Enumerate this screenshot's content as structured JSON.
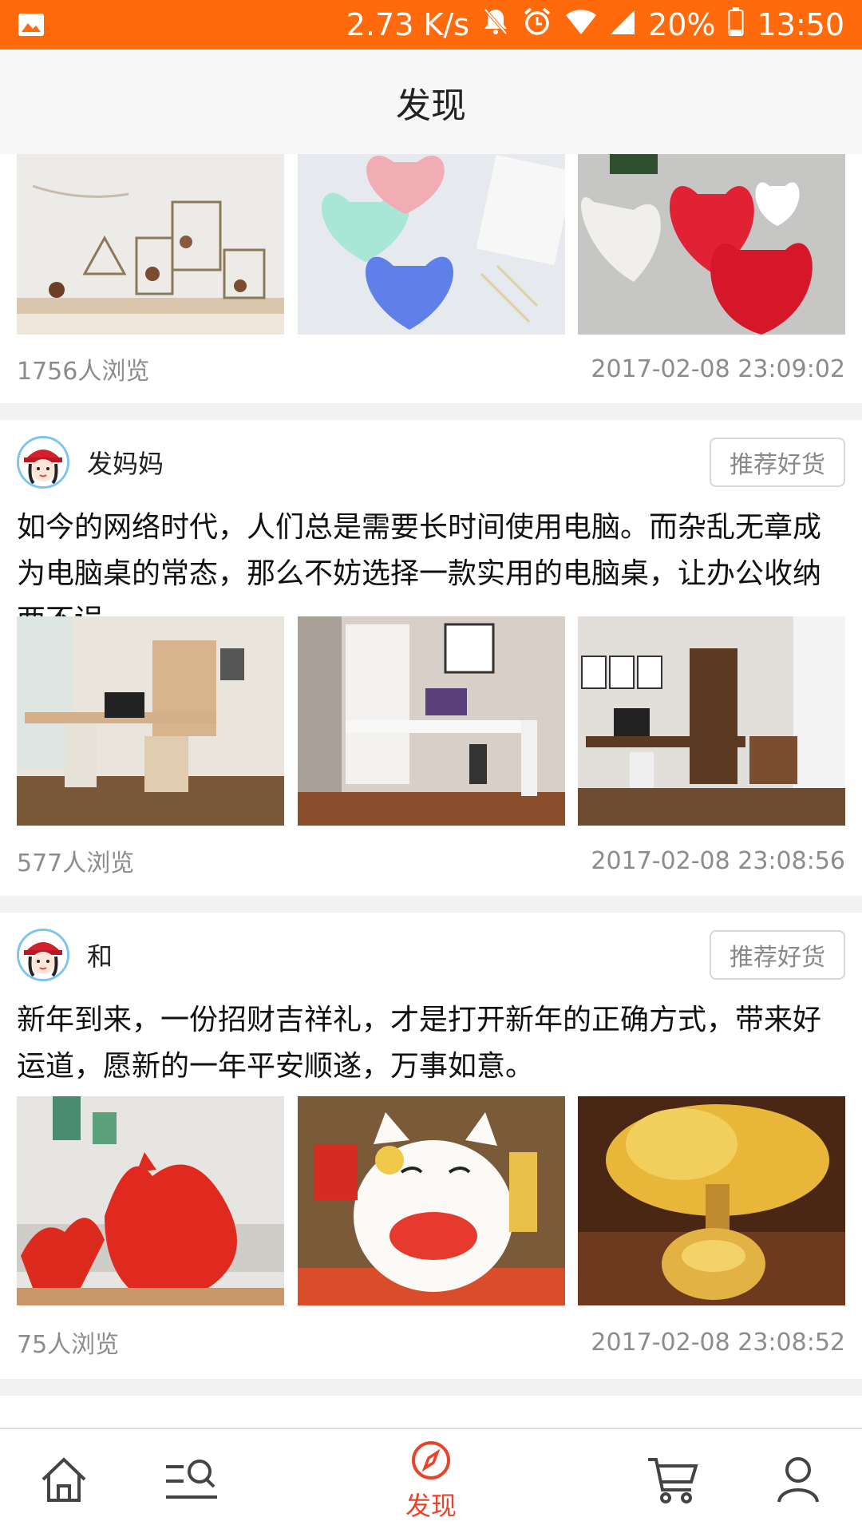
{
  "status_bar": {
    "speed": "2.73 K/s",
    "battery": "20%",
    "time": "13:50",
    "icons": [
      "image-icon",
      "mute-bell-icon",
      "alarm-icon",
      "wifi-icon",
      "signal-icon",
      "battery-icon"
    ]
  },
  "header": {
    "title": "发现"
  },
  "posts": [
    {
      "views": "1756人浏览",
      "date": "2017-02-08 23:09:02",
      "images": [
        "glass-terrarium-photo",
        "heart-dishes-photo",
        "heart-plates-photo"
      ]
    },
    {
      "author": "发妈妈",
      "tag_button": "推荐好货",
      "text": " 如今的网络时代，人们总是需要长时间使用电脑。而杂乱无章成为电脑桌的常态，那么不妨选择一款实用的电脑桌，让办公收纳两不误。",
      "views": "577人浏览",
      "date": "2017-02-08 23:08:56",
      "images": [
        "corner-desk-photo",
        "white-desk-photo",
        "wood-desk-photo"
      ]
    },
    {
      "author": "和",
      "tag_button": "推荐好货",
      "text": " 新年到来，一份招财吉祥礼，才是打开新年的正确方式，带来好运道，愿新的一年平安顺遂，万事如意。",
      "views": "75人浏览",
      "date": "2017-02-08 23:08:52",
      "images": [
        "red-rooster-photo",
        "lucky-cat-photo",
        "golden-tree-photo"
      ]
    }
  ],
  "tab_bar": {
    "active_label": "发现",
    "active_color": "#e8442b",
    "tabs": [
      "home-icon",
      "category-search-icon",
      "discover-compass-icon",
      "cart-icon",
      "profile-icon"
    ]
  },
  "colors": {
    "status_bar": "#ff6a0c",
    "accent": "#e8442b"
  }
}
